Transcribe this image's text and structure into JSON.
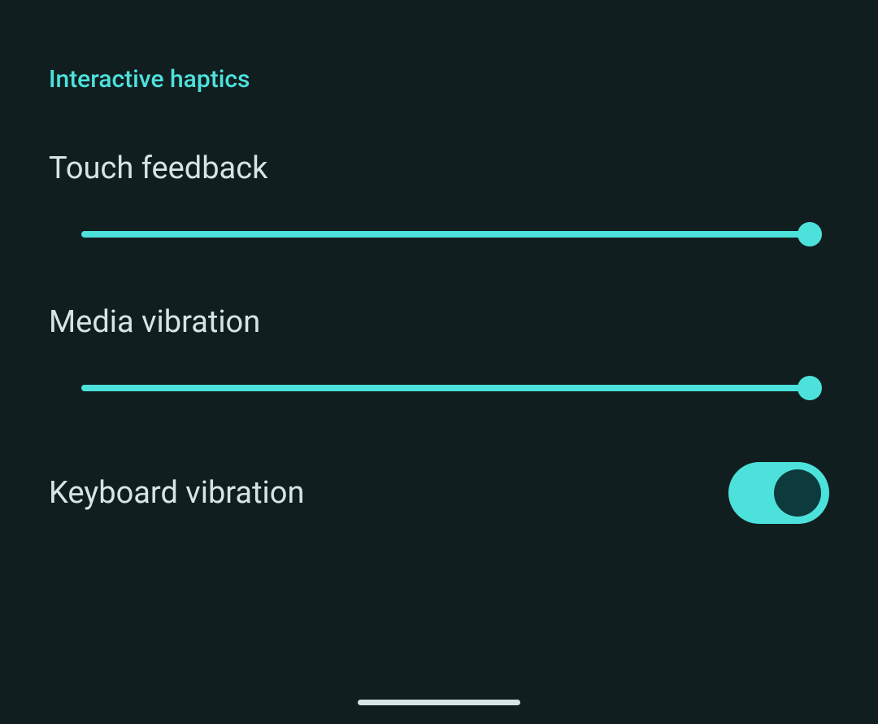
{
  "section": {
    "title": "Interactive haptics"
  },
  "settings": {
    "touch_feedback": {
      "label": "Touch feedback",
      "value": 100
    },
    "media_vibration": {
      "label": "Media vibration",
      "value": 100
    },
    "keyboard_vibration": {
      "label": "Keyboard vibration",
      "enabled": true
    }
  },
  "colors": {
    "background": "#111e20",
    "accent": "#4de1dc",
    "text": "#d6e4e3",
    "toggle_knob": "#0d3a3c"
  }
}
